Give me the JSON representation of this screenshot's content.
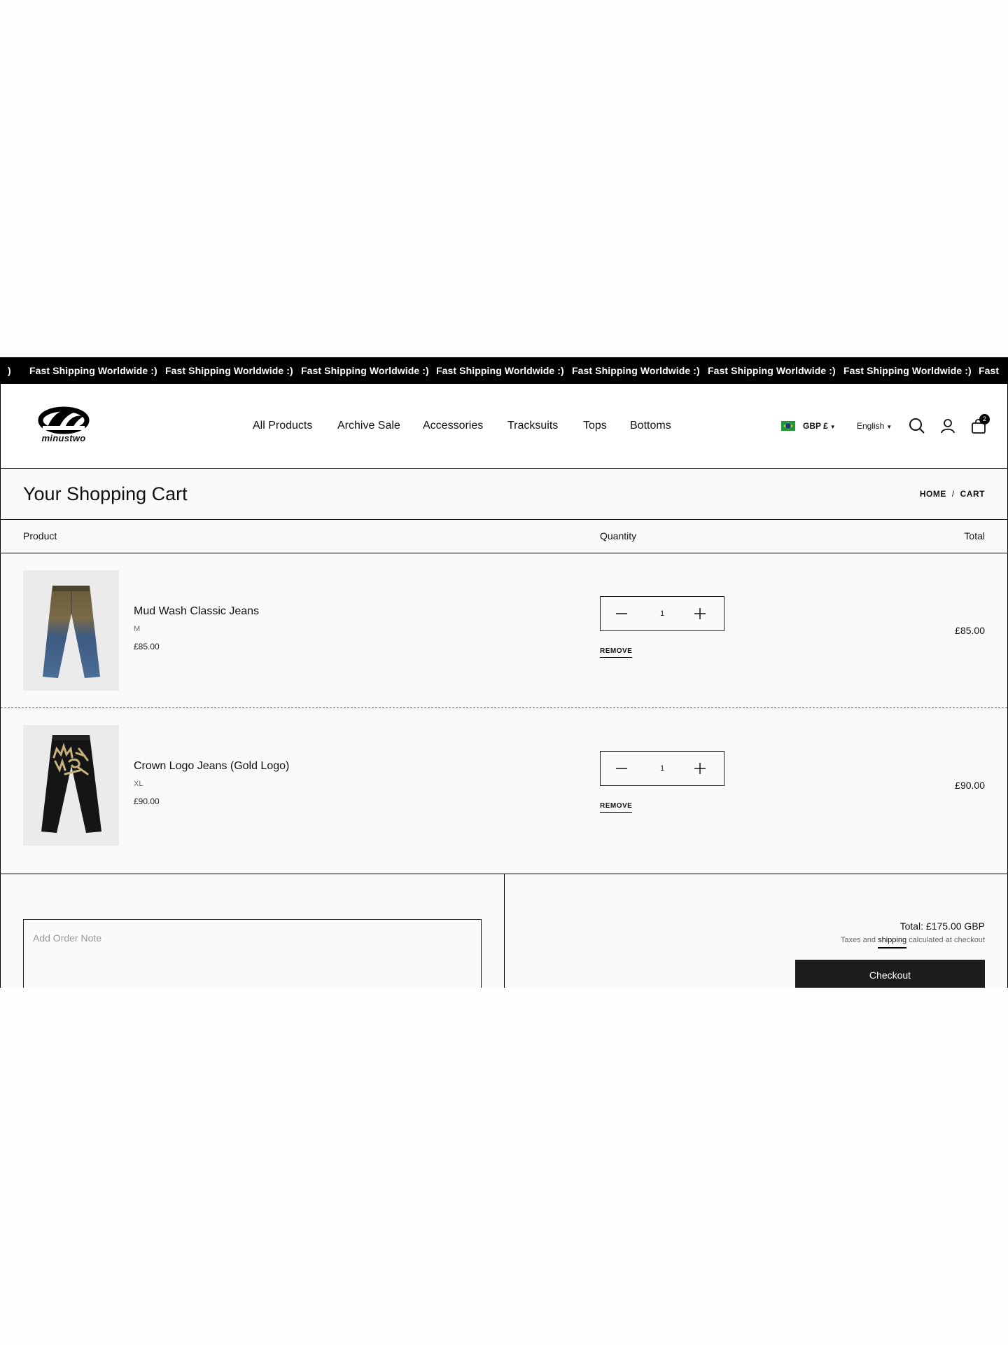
{
  "announcement": {
    "fragment": ")",
    "items": [
      "Fast Shipping Worldwide :)",
      "Fast Shipping Worldwide :)",
      "Fast Shipping Worldwide :)",
      "Fast Shipping Worldwide :)",
      "Fast Shipping Worldwide :)",
      "Fast Shipping Worldwide :)",
      "Fast Shipping Worldwide :)",
      "Fast"
    ]
  },
  "header": {
    "logo_text": "minustwo",
    "nav": [
      "All Products",
      "Archive Sale",
      "Accessories",
      "Tracksuits",
      "Tops",
      "Bottoms"
    ],
    "currency": "GBP £",
    "language": "English",
    "cart_count": "2",
    "icons": [
      "search-icon",
      "account-icon",
      "cart-icon",
      "brazil-flag-icon"
    ]
  },
  "page": {
    "title": "Your Shopping Cart",
    "breadcrumb": {
      "home": "HOME",
      "separator": "/",
      "current": "CART"
    }
  },
  "table": {
    "col_product": "Product",
    "col_quantity": "Quantity",
    "col_total": "Total"
  },
  "items": [
    {
      "name": "Mud Wash Classic Jeans",
      "variant": "M",
      "price": "£85.00",
      "quantity": "1",
      "remove": "REMOVE",
      "total": "£85.00"
    },
    {
      "name": "Crown Logo Jeans (Gold Logo)",
      "variant": "XL",
      "price": "£90.00",
      "quantity": "1",
      "remove": "REMOVE",
      "total": "£90.00"
    }
  ],
  "summary": {
    "note_placeholder": "Add Order Note",
    "total": "Total: £175.00 GBP",
    "tax_prefix": "Taxes and",
    "tax_link": "shipping",
    "tax_suffix": "calculated at checkout",
    "checkout_label": "Checkout"
  },
  "colors": {
    "primary": "#000000",
    "button": "#1c1c1c",
    "background": "#fafafa"
  }
}
